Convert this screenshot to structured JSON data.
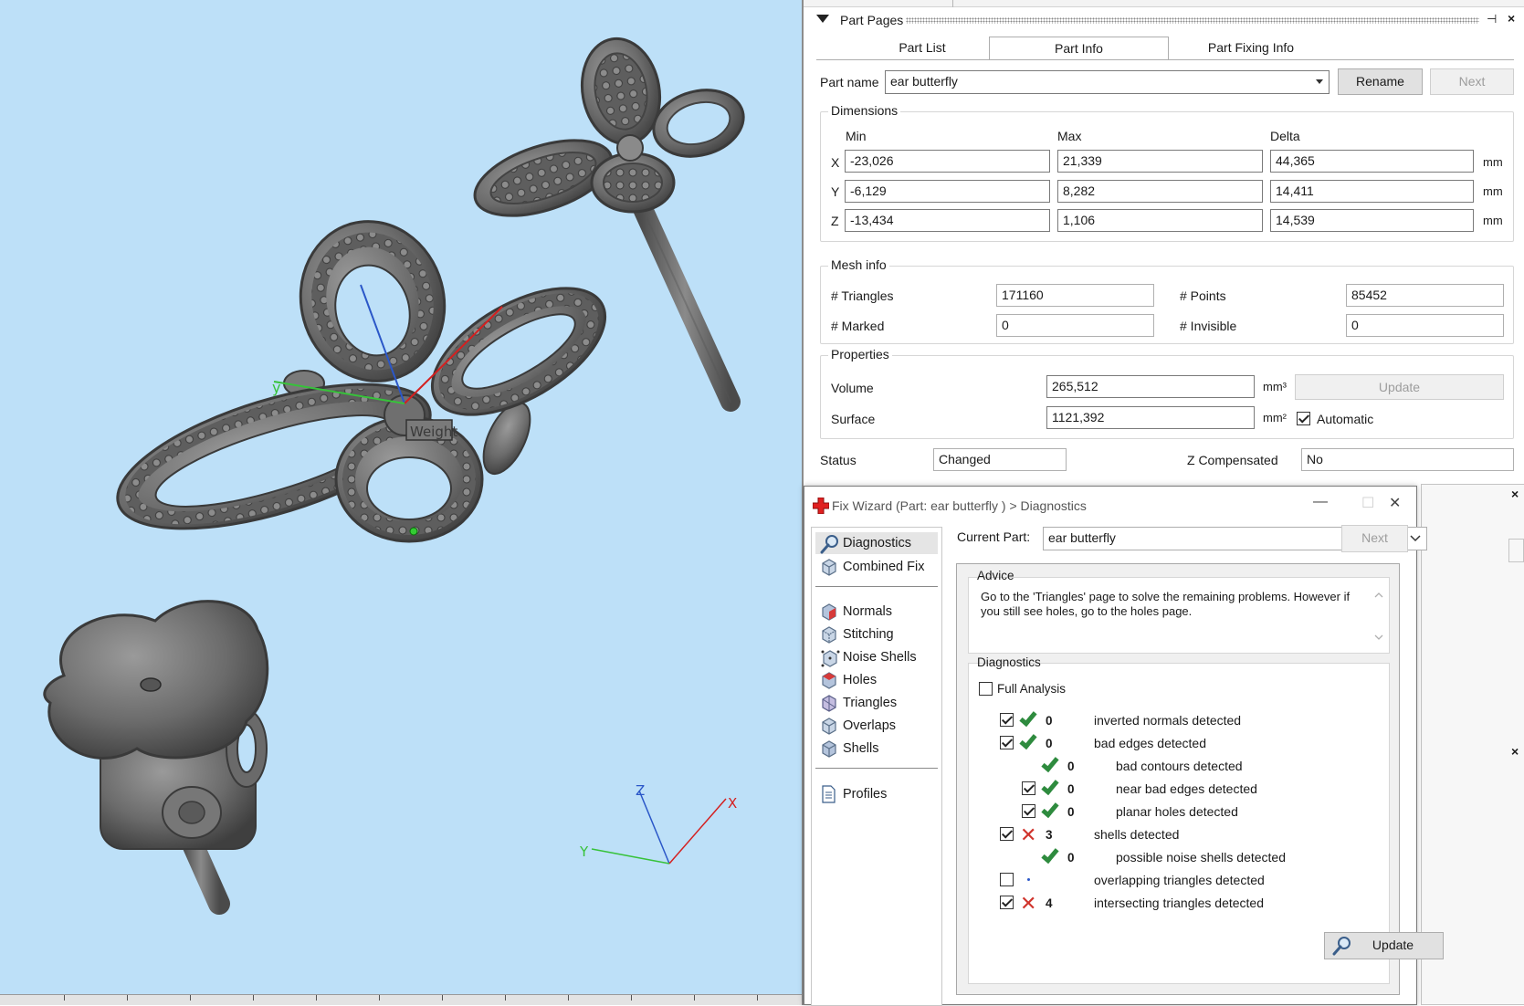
{
  "viewport": {
    "gizmo_labels": {
      "x": "X",
      "y": "Y",
      "z": "Z"
    },
    "model_axis_label": "y",
    "model_engraving": "Weight"
  },
  "part_pages": {
    "title": "Part Pages",
    "pin_icon": "pin-icon",
    "close_glyph": "×",
    "tabs": [
      "Part List",
      "Part Info",
      "Part Fixing Info"
    ],
    "active_tab": "Part Info",
    "part_name_label": "Part name",
    "part_name_value": "ear butterfly",
    "rename_label": "Rename",
    "next_label": "Next",
    "dimensions": {
      "title": "Dimensions",
      "headers": {
        "min": "Min",
        "max": "Max",
        "delta": "Delta"
      },
      "rows": [
        {
          "axis": "X",
          "min": "-23,026",
          "max": "21,339",
          "delta": "44,365",
          "unit": "mm"
        },
        {
          "axis": "Y",
          "min": "-6,129",
          "max": "8,282",
          "delta": "14,411",
          "unit": "mm"
        },
        {
          "axis": "Z",
          "min": "-13,434",
          "max": "1,106",
          "delta": "14,539",
          "unit": "mm"
        }
      ]
    },
    "mesh_info": {
      "title": "Mesh info",
      "triangles_label": "# Triangles",
      "triangles": "171160",
      "points_label": "# Points",
      "points": "85452",
      "marked_label": "# Marked",
      "marked": "0",
      "invisible_label": "# Invisible",
      "invisible": "0"
    },
    "properties": {
      "title": "Properties",
      "volume_label": "Volume",
      "volume": "265,512",
      "volume_unit": "mm³",
      "update_label": "Update",
      "surface_label": "Surface",
      "surface": "1121,392",
      "surface_unit": "mm²",
      "automatic_label": "Automatic",
      "automatic_checked": true
    },
    "status_label": "Status",
    "status": "Changed",
    "zcomp_label": "Z Compensated",
    "zcomp": "No"
  },
  "fix_wizard": {
    "title": "Fix Wizard (Part: ear butterfly ) > Diagnostics",
    "controls": {
      "minimize": "—",
      "maximize": "☐",
      "close": "✕"
    },
    "nav_top": [
      {
        "label": "Diagnostics",
        "icon": "magnifier-icon",
        "selected": true
      },
      {
        "label": "Combined Fix",
        "icon": "cube-icon"
      }
    ],
    "nav_mid": [
      {
        "label": "Normals",
        "icon": "normals-cube-icon"
      },
      {
        "label": "Stitching",
        "icon": "stitching-cube-icon"
      },
      {
        "label": "Noise Shells",
        "icon": "noise-shells-cube-icon"
      },
      {
        "label": "Holes",
        "icon": "holes-cube-icon"
      },
      {
        "label": "Triangles",
        "icon": "triangles-cube-icon"
      },
      {
        "label": "Overlaps",
        "icon": "overlaps-cube-icon"
      },
      {
        "label": "Shells",
        "icon": "shells-cube-icon"
      }
    ],
    "nav_bottom": [
      {
        "label": "Profiles",
        "icon": "document-icon"
      }
    ],
    "current_part_label": "Current Part:",
    "current_part_value": "ear butterfly",
    "next_label": "Next",
    "advice_title": "Advice",
    "advice_text": "Go to the 'Triangles' page to solve the remaining problems. However if you still see holes, go to the holes page.",
    "diagnostics_title": "Diagnostics",
    "full_analysis_label": "Full Analysis",
    "full_analysis_checked": false,
    "items": [
      {
        "checked": true,
        "status": "ok",
        "count": "0",
        "text": "inverted normals detected",
        "indent": 0,
        "has_checkbox": true
      },
      {
        "checked": true,
        "status": "ok",
        "count": "0",
        "text": "bad edges detected",
        "indent": 0,
        "has_checkbox": true
      },
      {
        "checked": false,
        "status": "ok",
        "count": "0",
        "text": "bad contours detected",
        "indent": 1,
        "has_checkbox": false
      },
      {
        "checked": true,
        "status": "ok",
        "count": "0",
        "text": "near bad edges detected",
        "indent": 1,
        "has_checkbox": true
      },
      {
        "checked": true,
        "status": "ok",
        "count": "0",
        "text": "planar holes detected",
        "indent": 1,
        "has_checkbox": true
      },
      {
        "checked": true,
        "status": "error",
        "count": "3",
        "text": "shells detected",
        "indent": 0,
        "has_checkbox": true
      },
      {
        "checked": false,
        "status": "ok",
        "count": "0",
        "text": "possible noise shells detected",
        "indent": 1,
        "has_checkbox": false
      },
      {
        "checked": false,
        "status": "none",
        "count": "",
        "text": "overlapping triangles detected",
        "indent": 0,
        "has_checkbox": true
      },
      {
        "checked": true,
        "status": "error",
        "count": "4",
        "text": "intersecting triangles detected",
        "indent": 0,
        "has_checkbox": true
      }
    ],
    "update_label": "Update"
  },
  "colors": {
    "viewport_bg": "#bde0f8",
    "model_gray": "#6e6e6e",
    "ok_green": "#2e8b3e",
    "error_red": "#d0342c",
    "wizard_icon_red": "#e02020"
  }
}
